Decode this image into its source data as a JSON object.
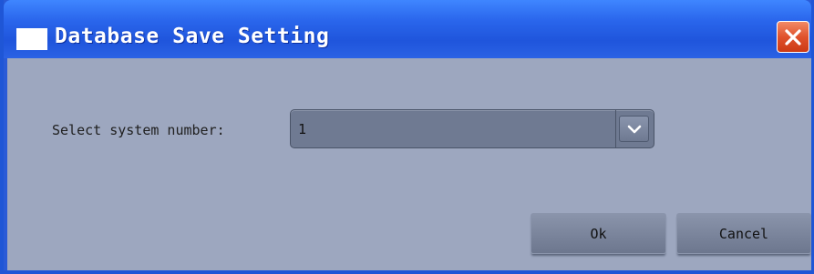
{
  "window": {
    "title": "Database Save Setting",
    "icon": "window-icon",
    "close_icon": "close-icon"
  },
  "form": {
    "system_number_label": "Select system number:",
    "system_number_value": "1",
    "dropdown_icon": "chevron-down-icon"
  },
  "buttons": {
    "ok_label": "Ok",
    "cancel_label": "Cancel"
  },
  "colors": {
    "titlebar": "#2a66ec",
    "client_background": "#9da7bf",
    "close_button": "#e0522c"
  }
}
